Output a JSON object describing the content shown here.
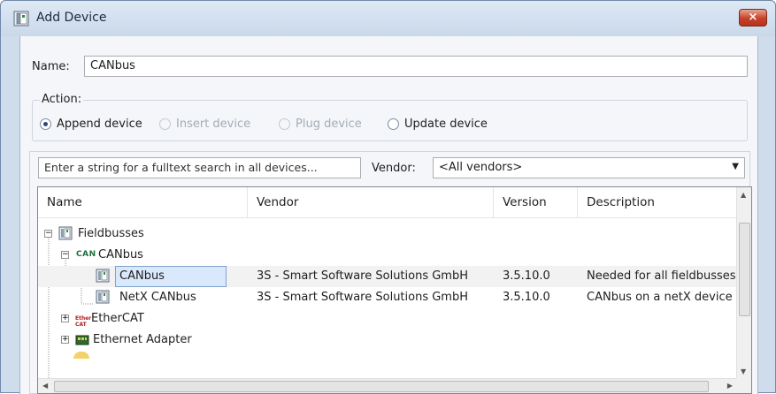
{
  "window": {
    "title": "Add Device",
    "close_label": "×"
  },
  "form": {
    "name_label": "Name:",
    "name_value": "CANbus",
    "action_label": "Action:",
    "actions": [
      {
        "label": "Append device",
        "checked": true,
        "enabled": true
      },
      {
        "label": "Insert device",
        "checked": false,
        "enabled": false
      },
      {
        "label": "Plug device",
        "checked": false,
        "enabled": false
      },
      {
        "label": "Update device",
        "checked": false,
        "enabled": true
      }
    ]
  },
  "search": {
    "placeholder": "Enter a string for a fulltext search in all devices...",
    "vendor_label": "Vendor:",
    "vendor_value": "<All vendors>"
  },
  "table": {
    "columns": [
      "Name",
      "Vendor",
      "Version",
      "Description"
    ],
    "rows": [
      {
        "name": "Fieldbusses",
        "vendor": "",
        "version": "",
        "description": ""
      },
      {
        "name": "CANbus",
        "vendor": "",
        "version": "",
        "description": ""
      },
      {
        "name": "CANbus",
        "vendor": "3S - Smart Software Solutions GmbH",
        "version": "3.5.10.0",
        "description": "Needed for all fieldbusses"
      },
      {
        "name": "NetX CANbus",
        "vendor": "3S - Smart Software Solutions GmbH",
        "version": "3.5.10.0",
        "description": "CANbus on a netX device"
      },
      {
        "name": "EtherCAT",
        "vendor": "",
        "version": "",
        "description": ""
      },
      {
        "name": "Ethernet Adapter",
        "vendor": "",
        "version": "",
        "description": ""
      }
    ],
    "can_logo_text": "CAN",
    "ethercat_logo_text": "EtherCAT"
  },
  "colors": {
    "accent": "#2a4a7a",
    "selection": "#d9e8fb",
    "close_button": "#c7412a"
  }
}
